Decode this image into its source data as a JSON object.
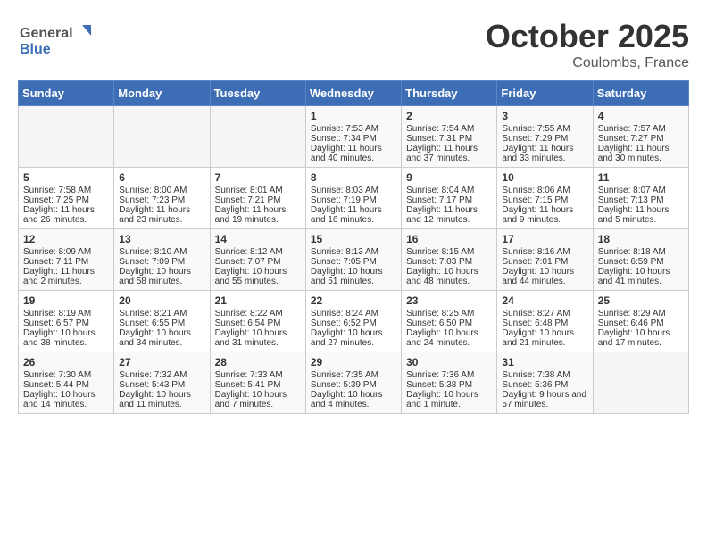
{
  "header": {
    "logo_general": "General",
    "logo_blue": "Blue",
    "month": "October 2025",
    "location": "Coulombs, France"
  },
  "days_of_week": [
    "Sunday",
    "Monday",
    "Tuesday",
    "Wednesday",
    "Thursday",
    "Friday",
    "Saturday"
  ],
  "weeks": [
    [
      {
        "day": "",
        "sunrise": "",
        "sunset": "",
        "daylight": ""
      },
      {
        "day": "",
        "sunrise": "",
        "sunset": "",
        "daylight": ""
      },
      {
        "day": "",
        "sunrise": "",
        "sunset": "",
        "daylight": ""
      },
      {
        "day": "1",
        "sunrise": "Sunrise: 7:53 AM",
        "sunset": "Sunset: 7:34 PM",
        "daylight": "Daylight: 11 hours and 40 minutes."
      },
      {
        "day": "2",
        "sunrise": "Sunrise: 7:54 AM",
        "sunset": "Sunset: 7:31 PM",
        "daylight": "Daylight: 11 hours and 37 minutes."
      },
      {
        "day": "3",
        "sunrise": "Sunrise: 7:55 AM",
        "sunset": "Sunset: 7:29 PM",
        "daylight": "Daylight: 11 hours and 33 minutes."
      },
      {
        "day": "4",
        "sunrise": "Sunrise: 7:57 AM",
        "sunset": "Sunset: 7:27 PM",
        "daylight": "Daylight: 11 hours and 30 minutes."
      }
    ],
    [
      {
        "day": "5",
        "sunrise": "Sunrise: 7:58 AM",
        "sunset": "Sunset: 7:25 PM",
        "daylight": "Daylight: 11 hours and 26 minutes."
      },
      {
        "day": "6",
        "sunrise": "Sunrise: 8:00 AM",
        "sunset": "Sunset: 7:23 PM",
        "daylight": "Daylight: 11 hours and 23 minutes."
      },
      {
        "day": "7",
        "sunrise": "Sunrise: 8:01 AM",
        "sunset": "Sunset: 7:21 PM",
        "daylight": "Daylight: 11 hours and 19 minutes."
      },
      {
        "day": "8",
        "sunrise": "Sunrise: 8:03 AM",
        "sunset": "Sunset: 7:19 PM",
        "daylight": "Daylight: 11 hours and 16 minutes."
      },
      {
        "day": "9",
        "sunrise": "Sunrise: 8:04 AM",
        "sunset": "Sunset: 7:17 PM",
        "daylight": "Daylight: 11 hours and 12 minutes."
      },
      {
        "day": "10",
        "sunrise": "Sunrise: 8:06 AM",
        "sunset": "Sunset: 7:15 PM",
        "daylight": "Daylight: 11 hours and 9 minutes."
      },
      {
        "day": "11",
        "sunrise": "Sunrise: 8:07 AM",
        "sunset": "Sunset: 7:13 PM",
        "daylight": "Daylight: 11 hours and 5 minutes."
      }
    ],
    [
      {
        "day": "12",
        "sunrise": "Sunrise: 8:09 AM",
        "sunset": "Sunset: 7:11 PM",
        "daylight": "Daylight: 11 hours and 2 minutes."
      },
      {
        "day": "13",
        "sunrise": "Sunrise: 8:10 AM",
        "sunset": "Sunset: 7:09 PM",
        "daylight": "Daylight: 10 hours and 58 minutes."
      },
      {
        "day": "14",
        "sunrise": "Sunrise: 8:12 AM",
        "sunset": "Sunset: 7:07 PM",
        "daylight": "Daylight: 10 hours and 55 minutes."
      },
      {
        "day": "15",
        "sunrise": "Sunrise: 8:13 AM",
        "sunset": "Sunset: 7:05 PM",
        "daylight": "Daylight: 10 hours and 51 minutes."
      },
      {
        "day": "16",
        "sunrise": "Sunrise: 8:15 AM",
        "sunset": "Sunset: 7:03 PM",
        "daylight": "Daylight: 10 hours and 48 minutes."
      },
      {
        "day": "17",
        "sunrise": "Sunrise: 8:16 AM",
        "sunset": "Sunset: 7:01 PM",
        "daylight": "Daylight: 10 hours and 44 minutes."
      },
      {
        "day": "18",
        "sunrise": "Sunrise: 8:18 AM",
        "sunset": "Sunset: 6:59 PM",
        "daylight": "Daylight: 10 hours and 41 minutes."
      }
    ],
    [
      {
        "day": "19",
        "sunrise": "Sunrise: 8:19 AM",
        "sunset": "Sunset: 6:57 PM",
        "daylight": "Daylight: 10 hours and 38 minutes."
      },
      {
        "day": "20",
        "sunrise": "Sunrise: 8:21 AM",
        "sunset": "Sunset: 6:55 PM",
        "daylight": "Daylight: 10 hours and 34 minutes."
      },
      {
        "day": "21",
        "sunrise": "Sunrise: 8:22 AM",
        "sunset": "Sunset: 6:54 PM",
        "daylight": "Daylight: 10 hours and 31 minutes."
      },
      {
        "day": "22",
        "sunrise": "Sunrise: 8:24 AM",
        "sunset": "Sunset: 6:52 PM",
        "daylight": "Daylight: 10 hours and 27 minutes."
      },
      {
        "day": "23",
        "sunrise": "Sunrise: 8:25 AM",
        "sunset": "Sunset: 6:50 PM",
        "daylight": "Daylight: 10 hours and 24 minutes."
      },
      {
        "day": "24",
        "sunrise": "Sunrise: 8:27 AM",
        "sunset": "Sunset: 6:48 PM",
        "daylight": "Daylight: 10 hours and 21 minutes."
      },
      {
        "day": "25",
        "sunrise": "Sunrise: 8:29 AM",
        "sunset": "Sunset: 6:46 PM",
        "daylight": "Daylight: 10 hours and 17 minutes."
      }
    ],
    [
      {
        "day": "26",
        "sunrise": "Sunrise: 7:30 AM",
        "sunset": "Sunset: 5:44 PM",
        "daylight": "Daylight: 10 hours and 14 minutes."
      },
      {
        "day": "27",
        "sunrise": "Sunrise: 7:32 AM",
        "sunset": "Sunset: 5:43 PM",
        "daylight": "Daylight: 10 hours and 11 minutes."
      },
      {
        "day": "28",
        "sunrise": "Sunrise: 7:33 AM",
        "sunset": "Sunset: 5:41 PM",
        "daylight": "Daylight: 10 hours and 7 minutes."
      },
      {
        "day": "29",
        "sunrise": "Sunrise: 7:35 AM",
        "sunset": "Sunset: 5:39 PM",
        "daylight": "Daylight: 10 hours and 4 minutes."
      },
      {
        "day": "30",
        "sunrise": "Sunrise: 7:36 AM",
        "sunset": "Sunset: 5:38 PM",
        "daylight": "Daylight: 10 hours and 1 minute."
      },
      {
        "day": "31",
        "sunrise": "Sunrise: 7:38 AM",
        "sunset": "Sunset: 5:36 PM",
        "daylight": "Daylight: 9 hours and 57 minutes."
      },
      {
        "day": "",
        "sunrise": "",
        "sunset": "",
        "daylight": ""
      }
    ]
  ]
}
